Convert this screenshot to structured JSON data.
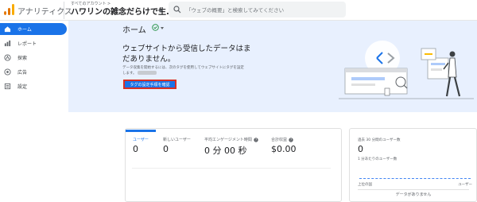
{
  "app": {
    "title": "アナリティクス",
    "account_small": "すべてのアカウント >",
    "account_name": "ハワリンの雑念だらけで生...",
    "search_placeholder": "「ウェブの概要」と検索してみてください"
  },
  "sidebar": {
    "items": [
      {
        "label": "ホーム",
        "icon": "home-icon",
        "active": true
      },
      {
        "label": "レポート",
        "icon": "reports-icon",
        "active": false
      },
      {
        "label": "探索",
        "icon": "explore-icon",
        "active": false
      },
      {
        "label": "広告",
        "icon": "advertising-icon",
        "active": false
      },
      {
        "label": "設定",
        "icon": "configure-icon",
        "active": false
      }
    ]
  },
  "hero": {
    "page_title": "ホーム",
    "heading": "ウェブサイトから受信したデータはまだありません。",
    "sub_text": "データ収集を開始するには、次のタグを使用してウェブサイトにタグを設定します。",
    "button_label": "タグの設定手順を確認"
  },
  "metrics": [
    {
      "label": "ユーザー",
      "value": "0",
      "selected": true,
      "help": false
    },
    {
      "label": "新しいユーザー",
      "value": "0",
      "selected": false,
      "help": false
    },
    {
      "label": "平均エンゲージメント時間",
      "value": "0 分 00 秒",
      "selected": false,
      "help": true
    },
    {
      "label": "合計収益",
      "value": "$0.00",
      "selected": false,
      "help": true
    }
  ],
  "realtime": {
    "label": "過去 30 分間のユーザー数",
    "value": "0",
    "sub_label": "1 分あたりのユーザー数",
    "axis_left": "上位の国",
    "axis_right": "ユーザー",
    "no_data": "データがありません"
  },
  "colors": {
    "accent": "#1a73e8",
    "hero_bg": "#e8f0fe",
    "button_outline": "#d93025"
  }
}
